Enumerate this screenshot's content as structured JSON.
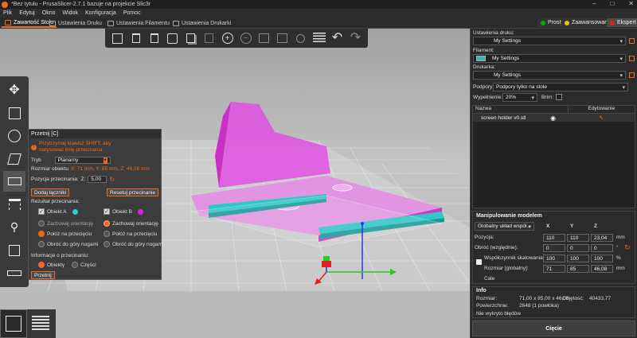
{
  "window": {
    "title": "*Bez tytułu - PrusaSlicer-2.7.1 bazuje na projekcie Slic3r",
    "controls": [
      "–",
      "□",
      "✕"
    ]
  },
  "menu": [
    "Plik",
    "Edytuj",
    "Okno",
    "Widok",
    "Konfiguracja",
    "Pomoc"
  ],
  "tabs": [
    {
      "label": "Zawartość Stołu",
      "active": true
    },
    {
      "label": "Ustawienia Druku",
      "active": false
    },
    {
      "label": "Ustawienia Filamentu",
      "active": false
    },
    {
      "label": "Ustawienia Drukarki",
      "active": false
    }
  ],
  "modes": [
    {
      "label": "Prosty",
      "color": "#00b000",
      "active": false
    },
    {
      "label": "Zaawansowane",
      "color": "#f0c000",
      "active": false
    },
    {
      "label": "Ekspert",
      "color": "#e02020",
      "active": true
    }
  ],
  "cut_panel": {
    "title": "Przetnij [C]",
    "hint": "Przytrzymaj klawisz SHIFT, aby narysować linię przecinania",
    "mode_label": "Tryb",
    "mode_value": "Planarny",
    "object_size_label": "Rozmiar obiektu",
    "object_size_value": "X: 71 mm,  Y: 85 mm,  Z: 46,08 mm",
    "cut_pos_label": "Pozycja przecinania:",
    "cut_pos_axis": "Z:",
    "cut_pos_value": "5,00",
    "add_connectors": "Dodaj łączniki",
    "reset_cut": "Resetuj przecinanie",
    "result_label": "Rezultat przecinania:",
    "object_a": {
      "label": "Obiekt A",
      "color": "#1ed4d4",
      "keep_orientation": "Zachowaj orientację",
      "place_on_cut": "Połóż na przecięciu",
      "flip_upside": "Obróć do góry nogami"
    },
    "object_b": {
      "label": "Obiekt B",
      "color": "#e020e0",
      "keep_orientation": "Zachowaj orientację",
      "place_on_cut": "Połóż na przecięciu",
      "flip_upside": "Obróć do góry nogami"
    },
    "cut_info_label": "Informacje o przecinaniu:",
    "info_objects": "Obiekty",
    "info_parts": "Części",
    "perform_cut": "Przetnij"
  },
  "sidebar": {
    "print_settings_label": "Ustawienia druku:",
    "print_settings_value": "My Settings",
    "filament_label": "Filament:",
    "filament_value": "My Settings",
    "filament_color": "#3ab5b5",
    "printer_label": "Drukarka:",
    "printer_value": "My Settings",
    "supports_label": "Podpory:",
    "supports_value": "Podpory tylko na stole",
    "infill_label": "Wypełnienie:",
    "infill_value": "20%",
    "brim_label": "Brim:",
    "list_headers": [
      "Nazwa",
      "Edytowanie"
    ],
    "objects": [
      {
        "name": "screen holder v0.stl"
      }
    ]
  },
  "manipulation": {
    "title": "Manipulowanie modelem",
    "coord_system": "Globalny układ współ...",
    "axes": [
      "X",
      "Y",
      "Z"
    ],
    "position_label": "Pozycja:",
    "position": [
      "110",
      "110",
      "23,04"
    ],
    "position_unit": "mm",
    "rotation_label": "Obróć (względnie):",
    "rotation": [
      "0",
      "0",
      "0"
    ],
    "rotation_unit": "°",
    "scale_label": "Współczynnik skalowania:",
    "scale": [
      "100",
      "100",
      "100"
    ],
    "scale_unit": "%",
    "size_label": "Rozmiar [globalny]:",
    "size": [
      "71",
      "85",
      "46,08"
    ],
    "size_unit": "mm",
    "inches_label": "Cale"
  },
  "info": {
    "title": "Info",
    "size_label": "Rozmiar:",
    "size_value": "71,00 x 85,00 x 46,08",
    "volume_label": "Objętość:",
    "volume_value": "40433,77",
    "facets_label": "Powierzchnie:",
    "facets_value": "2648 (1 powłoka)",
    "errors": "Nie wykryto błędów"
  },
  "slice_button": "Cięcie"
}
